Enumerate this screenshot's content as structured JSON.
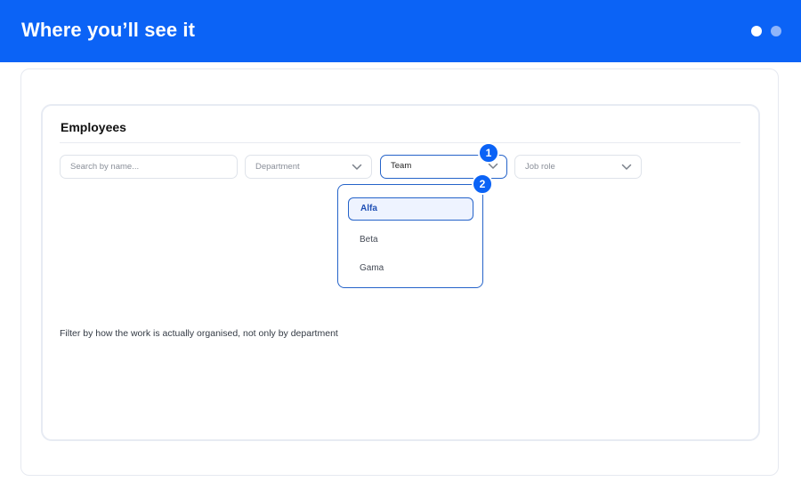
{
  "header": {
    "title": "Where you’ll see it",
    "accent_color": "#0b63f6"
  },
  "card": {
    "title": "Employees"
  },
  "filters": {
    "search_placeholder": "Search by name...",
    "department_label": "Department",
    "team_label": "Team",
    "job_role_label": "Job role"
  },
  "dropdown": {
    "selected": "Alfa",
    "options": [
      "Alfa",
      "Beta",
      "Gama"
    ]
  },
  "badges": {
    "first": "1",
    "second": "2"
  },
  "helper_text": "Filter by how the work is actually organised, not only by department",
  "icons": {
    "chevron": "chevron-down-icon",
    "pagination": "pagination-dots"
  }
}
